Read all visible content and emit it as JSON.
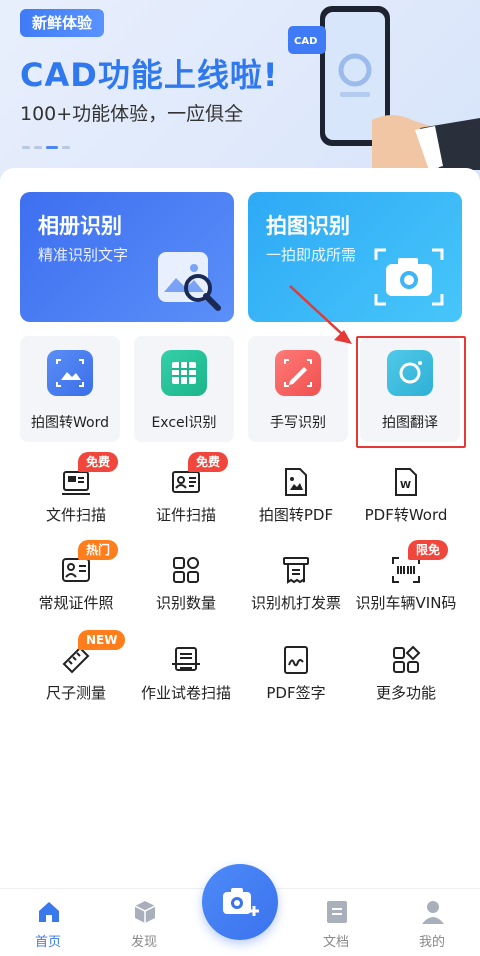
{
  "banner": {
    "tag": "新鲜体验",
    "title": "CAD功能上线啦!",
    "subtitle": "100+功能体验，一应俱全",
    "cad_label": "CAD"
  },
  "big_cards": [
    {
      "title": "相册识别",
      "subtitle": "精准识别文字"
    },
    {
      "title": "拍图识别",
      "subtitle": "一拍即成所需"
    }
  ],
  "tiles": [
    {
      "label": "拍图转Word"
    },
    {
      "label": "Excel识别"
    },
    {
      "label": "手写识别"
    },
    {
      "label": "拍图翻译"
    }
  ],
  "grid": [
    {
      "label": "文件扫描",
      "badge": "免费"
    },
    {
      "label": "证件扫描",
      "badge": "免费"
    },
    {
      "label": "拍图转PDF"
    },
    {
      "label": "PDF转Word"
    },
    {
      "label": "常规证件照",
      "badge": "热门"
    },
    {
      "label": "识别数量"
    },
    {
      "label": "识别机打发票"
    },
    {
      "label": "识别车辆VIN码",
      "badge": "限免"
    },
    {
      "label": "尺子测量",
      "badge": "NEW"
    },
    {
      "label": "作业试卷扫描"
    },
    {
      "label": "PDF签字"
    },
    {
      "label": "更多功能"
    }
  ],
  "nav": [
    {
      "label": "首页"
    },
    {
      "label": "发现"
    },
    {
      "label": "文档"
    },
    {
      "label": "我的"
    }
  ],
  "colors": {
    "accent": "#3a78ee",
    "badge_red": "#f0463c",
    "badge_orange": "#ff7d1a",
    "highlight": "#e53935"
  }
}
